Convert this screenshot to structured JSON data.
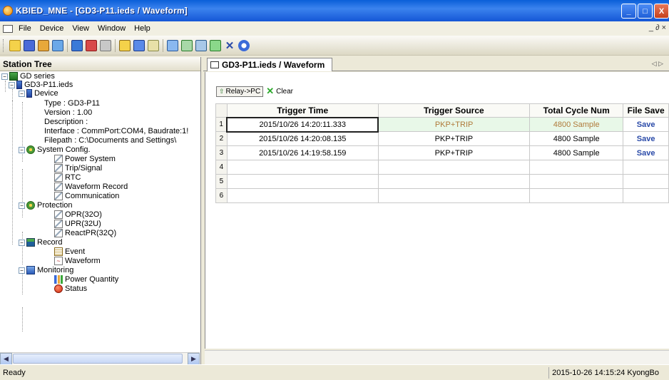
{
  "window": {
    "title": "KBIED_MNE - [GD3-P11.ieds / Waveform]",
    "min": "_",
    "max": "□",
    "close": "X"
  },
  "menu": {
    "items": [
      "File",
      "Device",
      "View",
      "Window",
      "Help"
    ],
    "mdi": "_ ∂ ×"
  },
  "toolbar": {
    "icons": [
      "open-icon",
      "save-icon",
      "connect-icon",
      "network-icon",
      "device-icon",
      "settings-icon",
      "refresh-icon",
      "link-icon",
      "monitor-icon",
      "list-icon",
      "window-icon",
      "tile-icon",
      "cascade-icon",
      "arrange-icon",
      "close-icon",
      "help-icon"
    ]
  },
  "station_tree": {
    "title": "Station Tree",
    "nodes": [
      {
        "label": "GD series"
      },
      {
        "label": "GD3-P11.ieds"
      },
      {
        "label": "Device"
      },
      {
        "label": "Type : GD3-P11"
      },
      {
        "label": "Version : 1.00"
      },
      {
        "label": "Description :"
      },
      {
        "label": "Interface : CommPort:COM4, Baudrate:1!"
      },
      {
        "label": "Filepath : C:\\Documents and Settings\\"
      },
      {
        "label": "System Config."
      },
      {
        "label": "Power System"
      },
      {
        "label": "Trip/Signal"
      },
      {
        "label": "RTC"
      },
      {
        "label": "Waveform Record"
      },
      {
        "label": "Communication"
      },
      {
        "label": "Protection"
      },
      {
        "label": "OPR(32O)"
      },
      {
        "label": "UPR(32U)"
      },
      {
        "label": "ReactPR(32Q)"
      },
      {
        "label": "Record"
      },
      {
        "label": "Event"
      },
      {
        "label": "Waveform"
      },
      {
        "label": "Monitoring"
      },
      {
        "label": "Power Quantity"
      },
      {
        "label": "Status"
      }
    ]
  },
  "document": {
    "tab_label": "GD3-P11.ieds / Waveform",
    "tab_nav": "◁ ▷",
    "relay_button": "Relay->PC",
    "clear_button": "Clear",
    "table": {
      "headers": [
        "Trigger Time",
        "Trigger Source",
        "Total Cycle Num",
        "File Save"
      ],
      "rows": [
        {
          "num": "1",
          "time": "2015/10/26 14:20:11.333",
          "source": "PKP+TRIP",
          "cycles": "4800 Sample",
          "save": "Save"
        },
        {
          "num": "2",
          "time": "2015/10/26 14:20:08.135",
          "source": "PKP+TRIP",
          "cycles": "4800 Sample",
          "save": "Save"
        },
        {
          "num": "3",
          "time": "2015/10/26 14:19:58.159",
          "source": "PKP+TRIP",
          "cycles": "4800 Sample",
          "save": "Save"
        },
        {
          "num": "4",
          "time": "",
          "source": "",
          "cycles": "",
          "save": ""
        },
        {
          "num": "5",
          "time": "",
          "source": "",
          "cycles": "",
          "save": ""
        },
        {
          "num": "6",
          "time": "",
          "source": "",
          "cycles": "",
          "save": ""
        }
      ]
    }
  },
  "status": {
    "left": "Ready",
    "right": "2015-10-26 14:15:24  KyongBo"
  },
  "colors": {
    "titlebar": "#1556d6",
    "selected_text": "#b07a3a",
    "save_link": "#2a4aa8"
  }
}
